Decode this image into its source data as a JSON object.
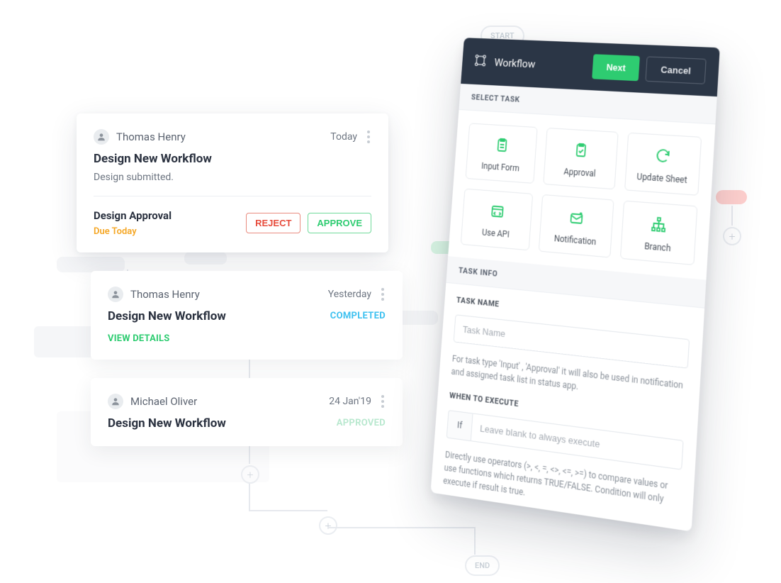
{
  "bg": {
    "start_label": "START",
    "end_label": "END"
  },
  "cards": {
    "card1": {
      "user": "Thomas Henry",
      "date": "Today",
      "title": "Design New Workflow",
      "subtext": "Design submitted.",
      "approval_title": "Design Approval",
      "due": "Due Today",
      "reject_label": "REJECT",
      "approve_label": "APPROVE"
    },
    "card2": {
      "user": "Thomas Henry",
      "date": "Yesterday",
      "title": "Design New Workflow",
      "status": "COMPLETED",
      "view_details_label": "VIEW DETAILS"
    },
    "card3": {
      "user": "Michael Oliver",
      "date": "24 Jan'19",
      "title": "Design New Workflow",
      "status": "APPROVED"
    }
  },
  "panel": {
    "header_title": "Workflow",
    "next_label": "Next",
    "cancel_label": "Cancel",
    "select_task_label": "SELECT TASK",
    "task_info_label": "TASK INFO",
    "tiles": {
      "input_form": "Input Form",
      "approval": "Approval",
      "update_sheet": "Update Sheet",
      "use_api": "Use API",
      "notification": "Notification",
      "branch": "Branch"
    },
    "task_name_label": "TASK NAME",
    "task_name_placeholder": "Task Name",
    "task_name_hint": "For task type 'Input' , 'Approval' it will also be used in notification and assigned task list in status app.",
    "when_label": "WHEN TO EXECUTE",
    "when_prefix": "If",
    "when_placeholder": "Leave blank to always execute",
    "when_hint": "Directly use operators (>, <, =, <>, <=, >=) to compare values or use functions which returns TRUE/FALSE. Condition will only execute if result is true."
  }
}
